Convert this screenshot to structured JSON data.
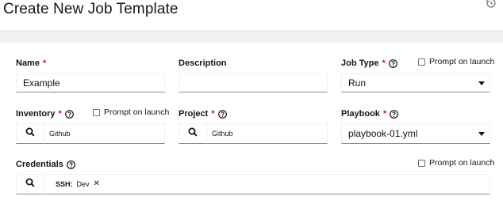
{
  "page": {
    "title": "Create New Job Template",
    "history_icon": "history-icon"
  },
  "fields": {
    "name": {
      "label": "Name",
      "required": "*",
      "value": "Example"
    },
    "description": {
      "label": "Description",
      "value": ""
    },
    "job_type": {
      "label": "Job Type",
      "required": "*",
      "value": "Run",
      "prompt_label": "Prompt on launch",
      "prompt_checked": false
    },
    "inventory": {
      "label": "Inventory",
      "required": "*",
      "value": "Github",
      "prompt_label": "Prompt on launch",
      "prompt_checked": false
    },
    "project": {
      "label": "Project",
      "required": "*",
      "value": "Github"
    },
    "playbook": {
      "label": "Playbook",
      "required": "*",
      "value": "playbook-01.yml"
    },
    "credentials": {
      "label": "Credentials",
      "prompt_label": "Prompt on launch",
      "prompt_checked": false,
      "chips": [
        {
          "key": "SSH:",
          "value": "Dev",
          "remove": "✕"
        }
      ]
    }
  },
  "colors": {
    "required": "#c9190b",
    "band": "#f0f0f0",
    "input_underline": "#8a8d90"
  }
}
